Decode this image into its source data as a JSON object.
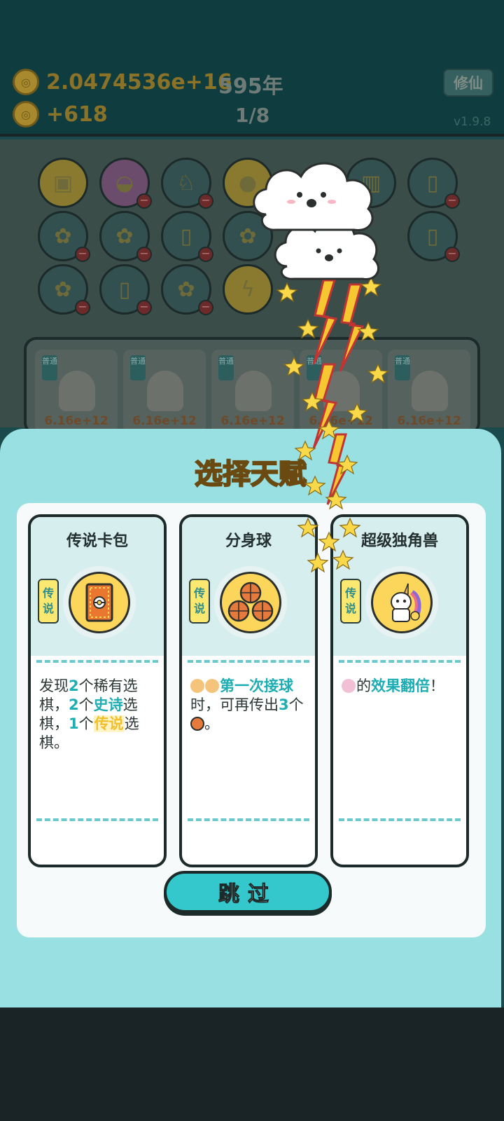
{
  "status": {
    "coins": "2.0474536e+16",
    "income": "+618",
    "year": "595年",
    "wave": "1/8",
    "cultivate_label": "修仙",
    "version": "v1.9.8"
  },
  "bench": {
    "items": [
      {
        "tag": "普通",
        "price": "6.16e+12"
      },
      {
        "tag": "普通",
        "price": "6.16e+12"
      },
      {
        "tag": "普通",
        "price": "6.16e+12"
      },
      {
        "tag": "普通",
        "price": "6.16e+12"
      },
      {
        "tag": "普通",
        "price": "6.16e+12"
      }
    ]
  },
  "panel": {
    "title": "选择天赋",
    "skip_label": "跳过",
    "cards": [
      {
        "name": "传说卡包",
        "rarity": [
          "传",
          "说"
        ],
        "icon": "card-pack-icon",
        "desc": {
          "t1": "发现",
          "n1": "2",
          "t2": "个稀有选棋，",
          "n2": "2",
          "t3": "个",
          "h1": "史诗",
          "t4": "选棋，",
          "n3": "1",
          "t5": "个",
          "h2": "传说",
          "t6": "选棋。"
        }
      },
      {
        "name": "分身球",
        "rarity": [
          "传",
          "说"
        ],
        "icon": "triple-basketball-icon",
        "desc": {
          "h1": "第一次接球",
          "t1": "时，可再传出",
          "n1": "3",
          "t2": "个",
          "t3": "。"
        }
      },
      {
        "name": "超级独角兽",
        "rarity": [
          "传",
          "说"
        ],
        "icon": "unicorn-icon",
        "desc": {
          "t1": "的",
          "h1": "效果翻倍",
          "t2": "！"
        }
      }
    ]
  },
  "colors": {
    "panel_bg": "#98e0e2",
    "accent_teal": "#34c7cb",
    "title_gold": "#f6c730",
    "rarity_badge": "#fbe870"
  }
}
